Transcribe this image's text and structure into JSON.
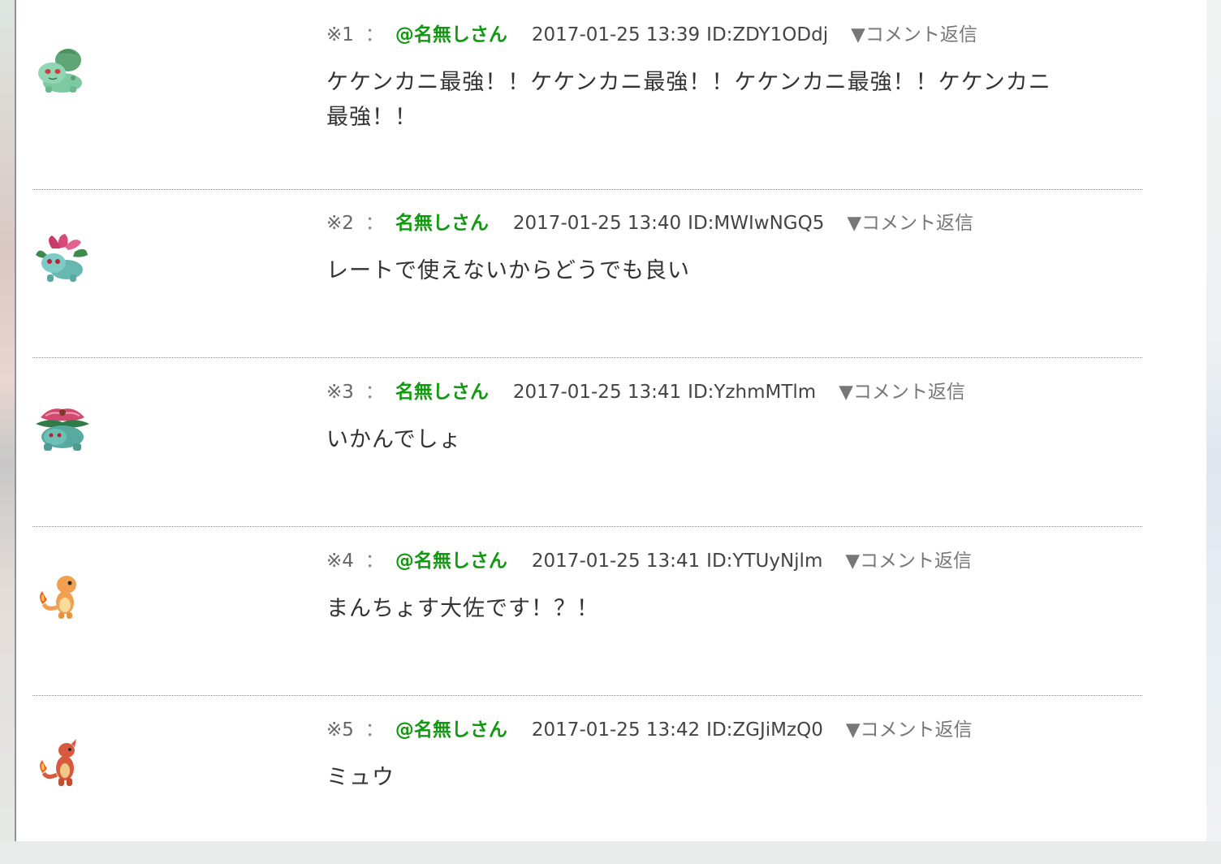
{
  "comments": [
    {
      "num": "※1",
      "colon": "：",
      "name": "@名無しさん",
      "date": "2017-01-25 13:39",
      "id": "ID:ZDY1ODdj",
      "reply": "▼コメント返信",
      "body": "ケケンカニ最強！！ケケンカニ最強！！ケケンカニ最強！！ケケンカニ最強！！",
      "avatar_icon": "bulbasaur-icon"
    },
    {
      "num": "※2",
      "colon": "：",
      "name": "名無しさん",
      "date": "2017-01-25 13:40",
      "id": "ID:MWIwNGQ5",
      "reply": "▼コメント返信",
      "body": "レートで使えないからどうでも良い",
      "avatar_icon": "ivysaur-icon"
    },
    {
      "num": "※3",
      "colon": "：",
      "name": "名無しさん",
      "date": "2017-01-25 13:41",
      "id": "ID:YzhmMTlm",
      "reply": "▼コメント返信",
      "body": "いかんでしょ",
      "avatar_icon": "venusaur-icon"
    },
    {
      "num": "※4",
      "colon": "：",
      "name": "@名無しさん",
      "date": "2017-01-25 13:41",
      "id": "ID:YTUyNjlm",
      "reply": "▼コメント返信",
      "body": "まんちょす大佐です！？！",
      "avatar_icon": "charmander-icon"
    },
    {
      "num": "※5",
      "colon": "：",
      "name": "@名無しさん",
      "date": "2017-01-25 13:42",
      "id": "ID:ZGJiMzQ0",
      "reply": "▼コメント返信",
      "body": "ミュウ",
      "avatar_icon": "charmeleon-icon"
    }
  ],
  "colors": {
    "name": "#119911",
    "text": "#333333",
    "meta": "#555555",
    "separator": "#8a8a8a"
  }
}
